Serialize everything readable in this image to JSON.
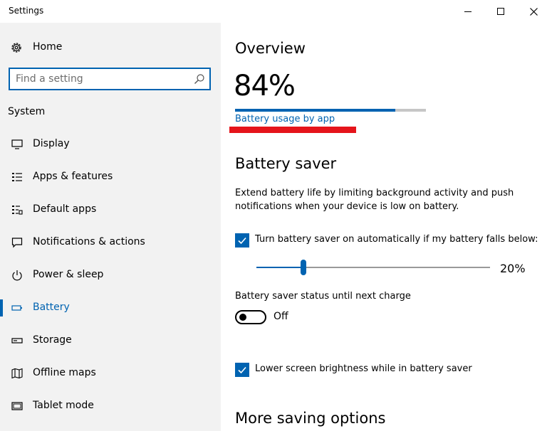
{
  "window": {
    "title": "Settings"
  },
  "sidebar": {
    "home_label": "Home",
    "search_placeholder": "Find a setting",
    "section_label": "System",
    "items": [
      {
        "label": "Display",
        "icon": "display-icon"
      },
      {
        "label": "Apps & features",
        "icon": "apps-list-icon"
      },
      {
        "label": "Default apps",
        "icon": "default-apps-icon"
      },
      {
        "label": "Notifications & actions",
        "icon": "notification-icon"
      },
      {
        "label": "Power & sleep",
        "icon": "power-icon"
      },
      {
        "label": "Battery",
        "icon": "battery-icon",
        "active": true
      },
      {
        "label": "Storage",
        "icon": "storage-icon"
      },
      {
        "label": "Offline maps",
        "icon": "map-icon"
      },
      {
        "label": "Tablet mode",
        "icon": "tablet-icon"
      }
    ]
  },
  "main": {
    "overview_heading": "Overview",
    "battery_percent": "84%",
    "battery_fraction": 0.84,
    "usage_link": "Battery usage by app",
    "saver_heading": "Battery saver",
    "saver_description": "Extend battery life by limiting background activity and push notifications when your device is low on battery.",
    "auto_saver_label": "Turn battery saver on automatically if my battery falls below:",
    "auto_saver_checked": true,
    "threshold_fraction": 0.2,
    "threshold_label": "20%",
    "status_label": "Battery saver status until next charge",
    "status_toggle_label": "Off",
    "brightness_label": "Lower screen brightness while in battery saver",
    "brightness_checked": true,
    "more_heading": "More saving options"
  },
  "colors": {
    "accent": "#0063b1",
    "sidebar_bg": "#f2f2f2",
    "annotation_red": "#e5141b"
  }
}
